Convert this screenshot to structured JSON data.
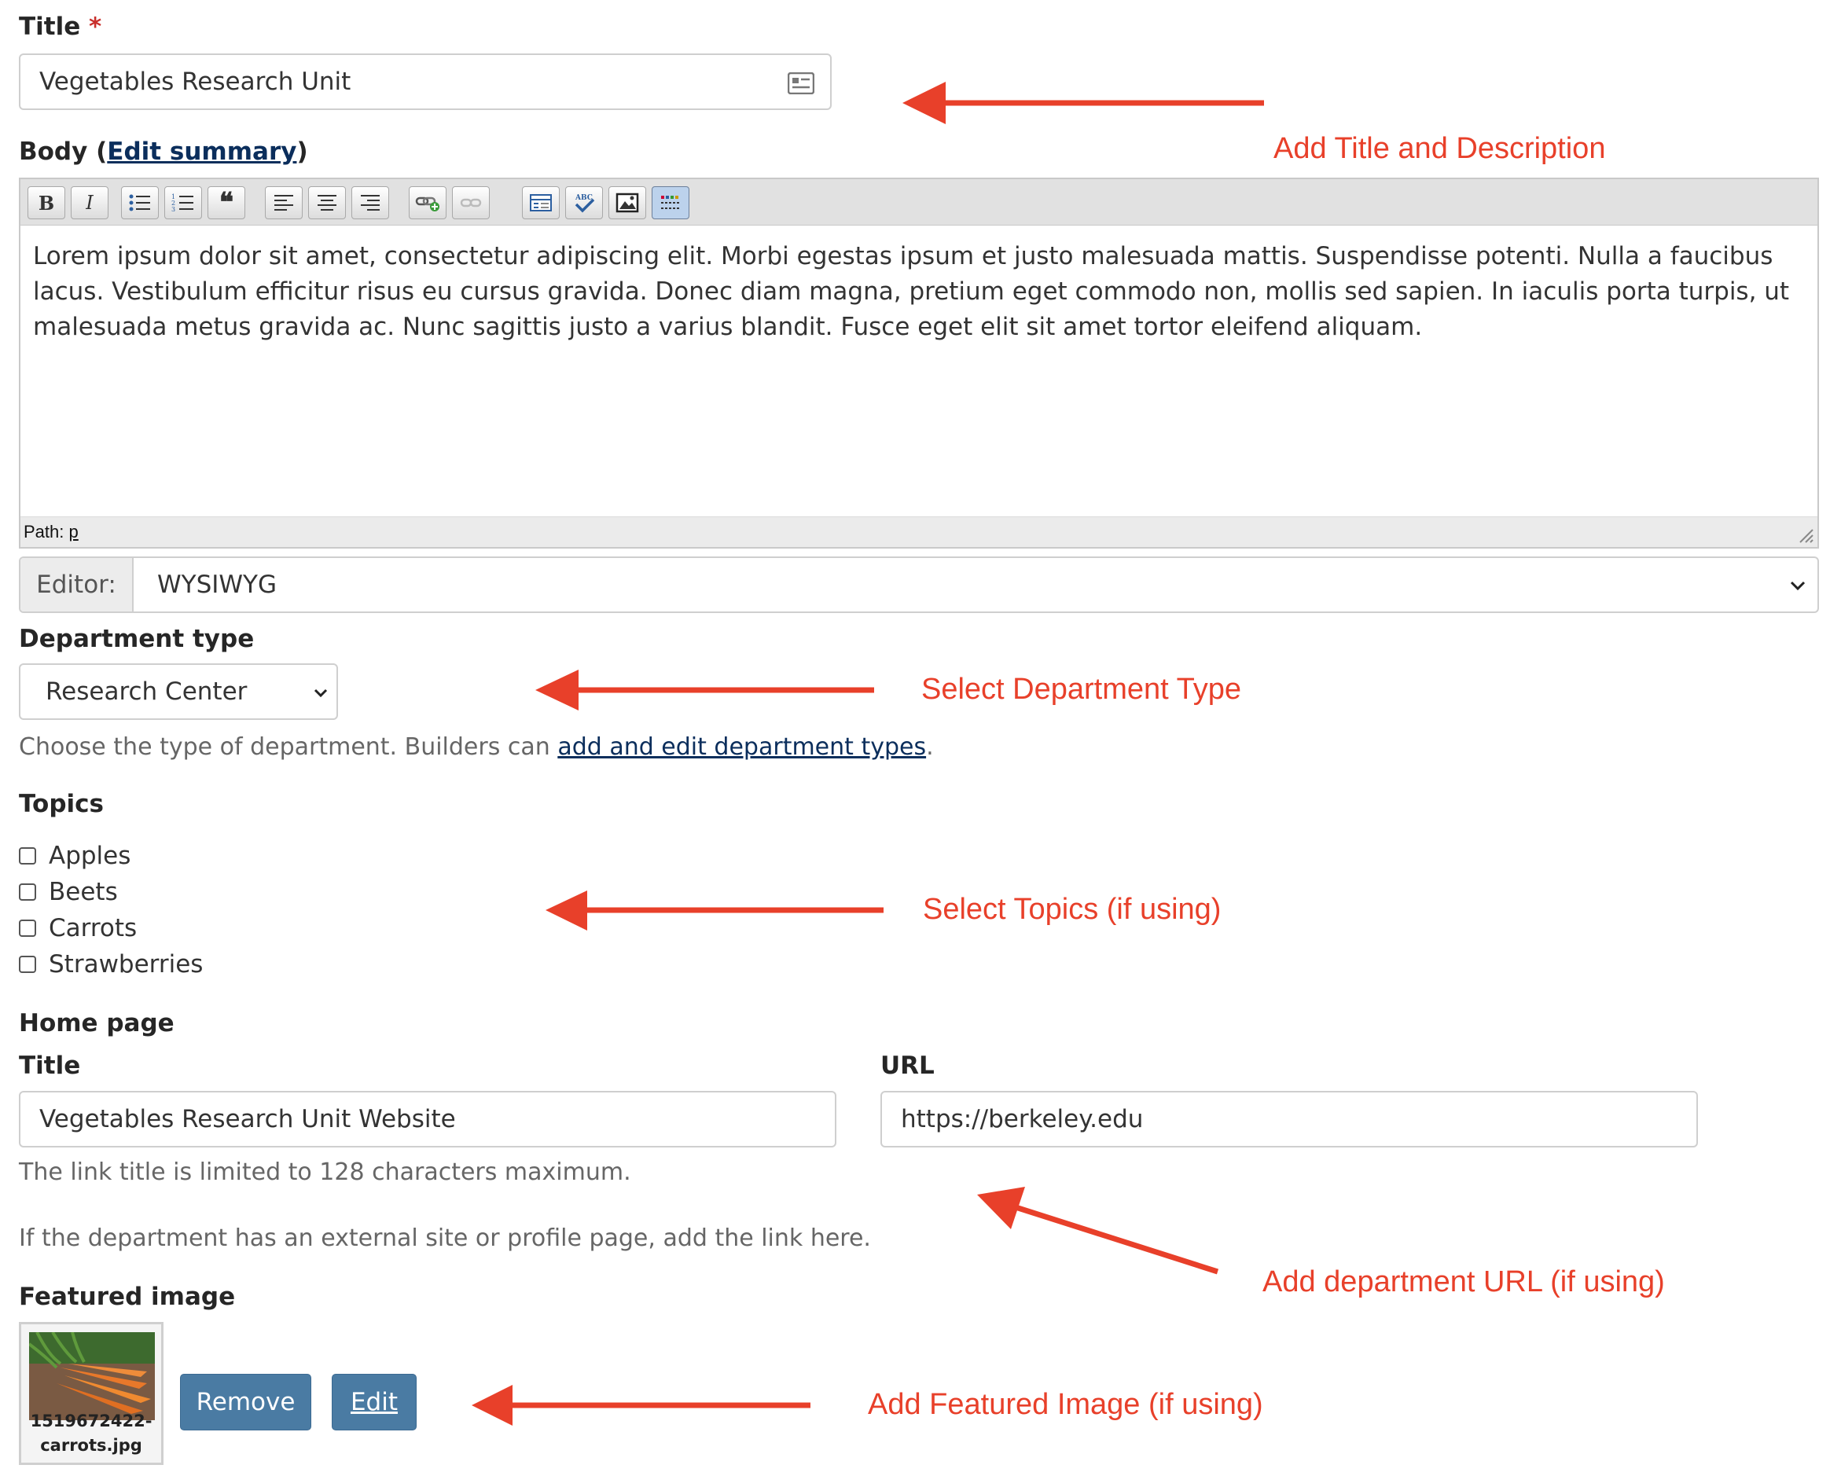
{
  "title_field": {
    "label": "Title",
    "required_mark": "*",
    "value": "Vegetables Research Unit"
  },
  "body_field": {
    "label": "Body",
    "edit_summary_link": "Edit summary",
    "toolbar": [
      "bold",
      "italic",
      "bulleted-list",
      "numbered-list",
      "blockquote",
      "align-left",
      "align-center",
      "align-right",
      "insert-link",
      "unlink",
      "teaser-break",
      "spellcheck",
      "insert-image",
      "toggle-toolbar"
    ],
    "text": "Lorem ipsum dolor sit amet, consectetur adipiscing elit. Morbi egestas ipsum et justo malesuada mattis. Suspendisse potenti. Nulla a faucibus lacus. Vestibulum efficitur risus eu cursus gravida. Donec diam magna, pretium eget commodo non, mollis sed sapien. In iaculis porta turpis, ut malesuada metus gravida ac. Nunc sagittis justo a varius blandit. Fusce eget elit sit amet tortor eleifend aliquam.",
    "path_label": "Path:",
    "path_value": "p"
  },
  "editor_select": {
    "label": "Editor:",
    "value": "WYSIWYG"
  },
  "department_type": {
    "label": "Department type",
    "value": "Research Center",
    "help_prefix": "Choose the type of department. Builders can ",
    "help_link": "add and edit department types",
    "help_suffix": "."
  },
  "topics": {
    "label": "Topics",
    "options": [
      "Apples",
      "Beets",
      "Carrots",
      "Strawberries"
    ]
  },
  "home_page": {
    "label": "Home page",
    "title_label": "Title",
    "title_value": "Vegetables Research Unit Website",
    "url_label": "URL",
    "url_value": "https://berkeley.edu",
    "title_help": "The link title is limited to 128 characters maximum.",
    "help": "If the department has an external site or profile page, add the link here."
  },
  "featured_image": {
    "label": "Featured image",
    "filename_line1": "1519672422-",
    "filename_line2": "carrots.jpg",
    "remove_label": "Remove",
    "edit_label": "Edit"
  },
  "annotations": {
    "title": "Add Title and Description",
    "department": "Select Department Type",
    "topics": "Select Topics (if using)",
    "url": "Add department URL (if using)",
    "image": "Add Featured Image (if using)"
  },
  "colors": {
    "annotation": "#e8402a",
    "button": "#4a7ba3",
    "link": "#0b2e5c"
  }
}
